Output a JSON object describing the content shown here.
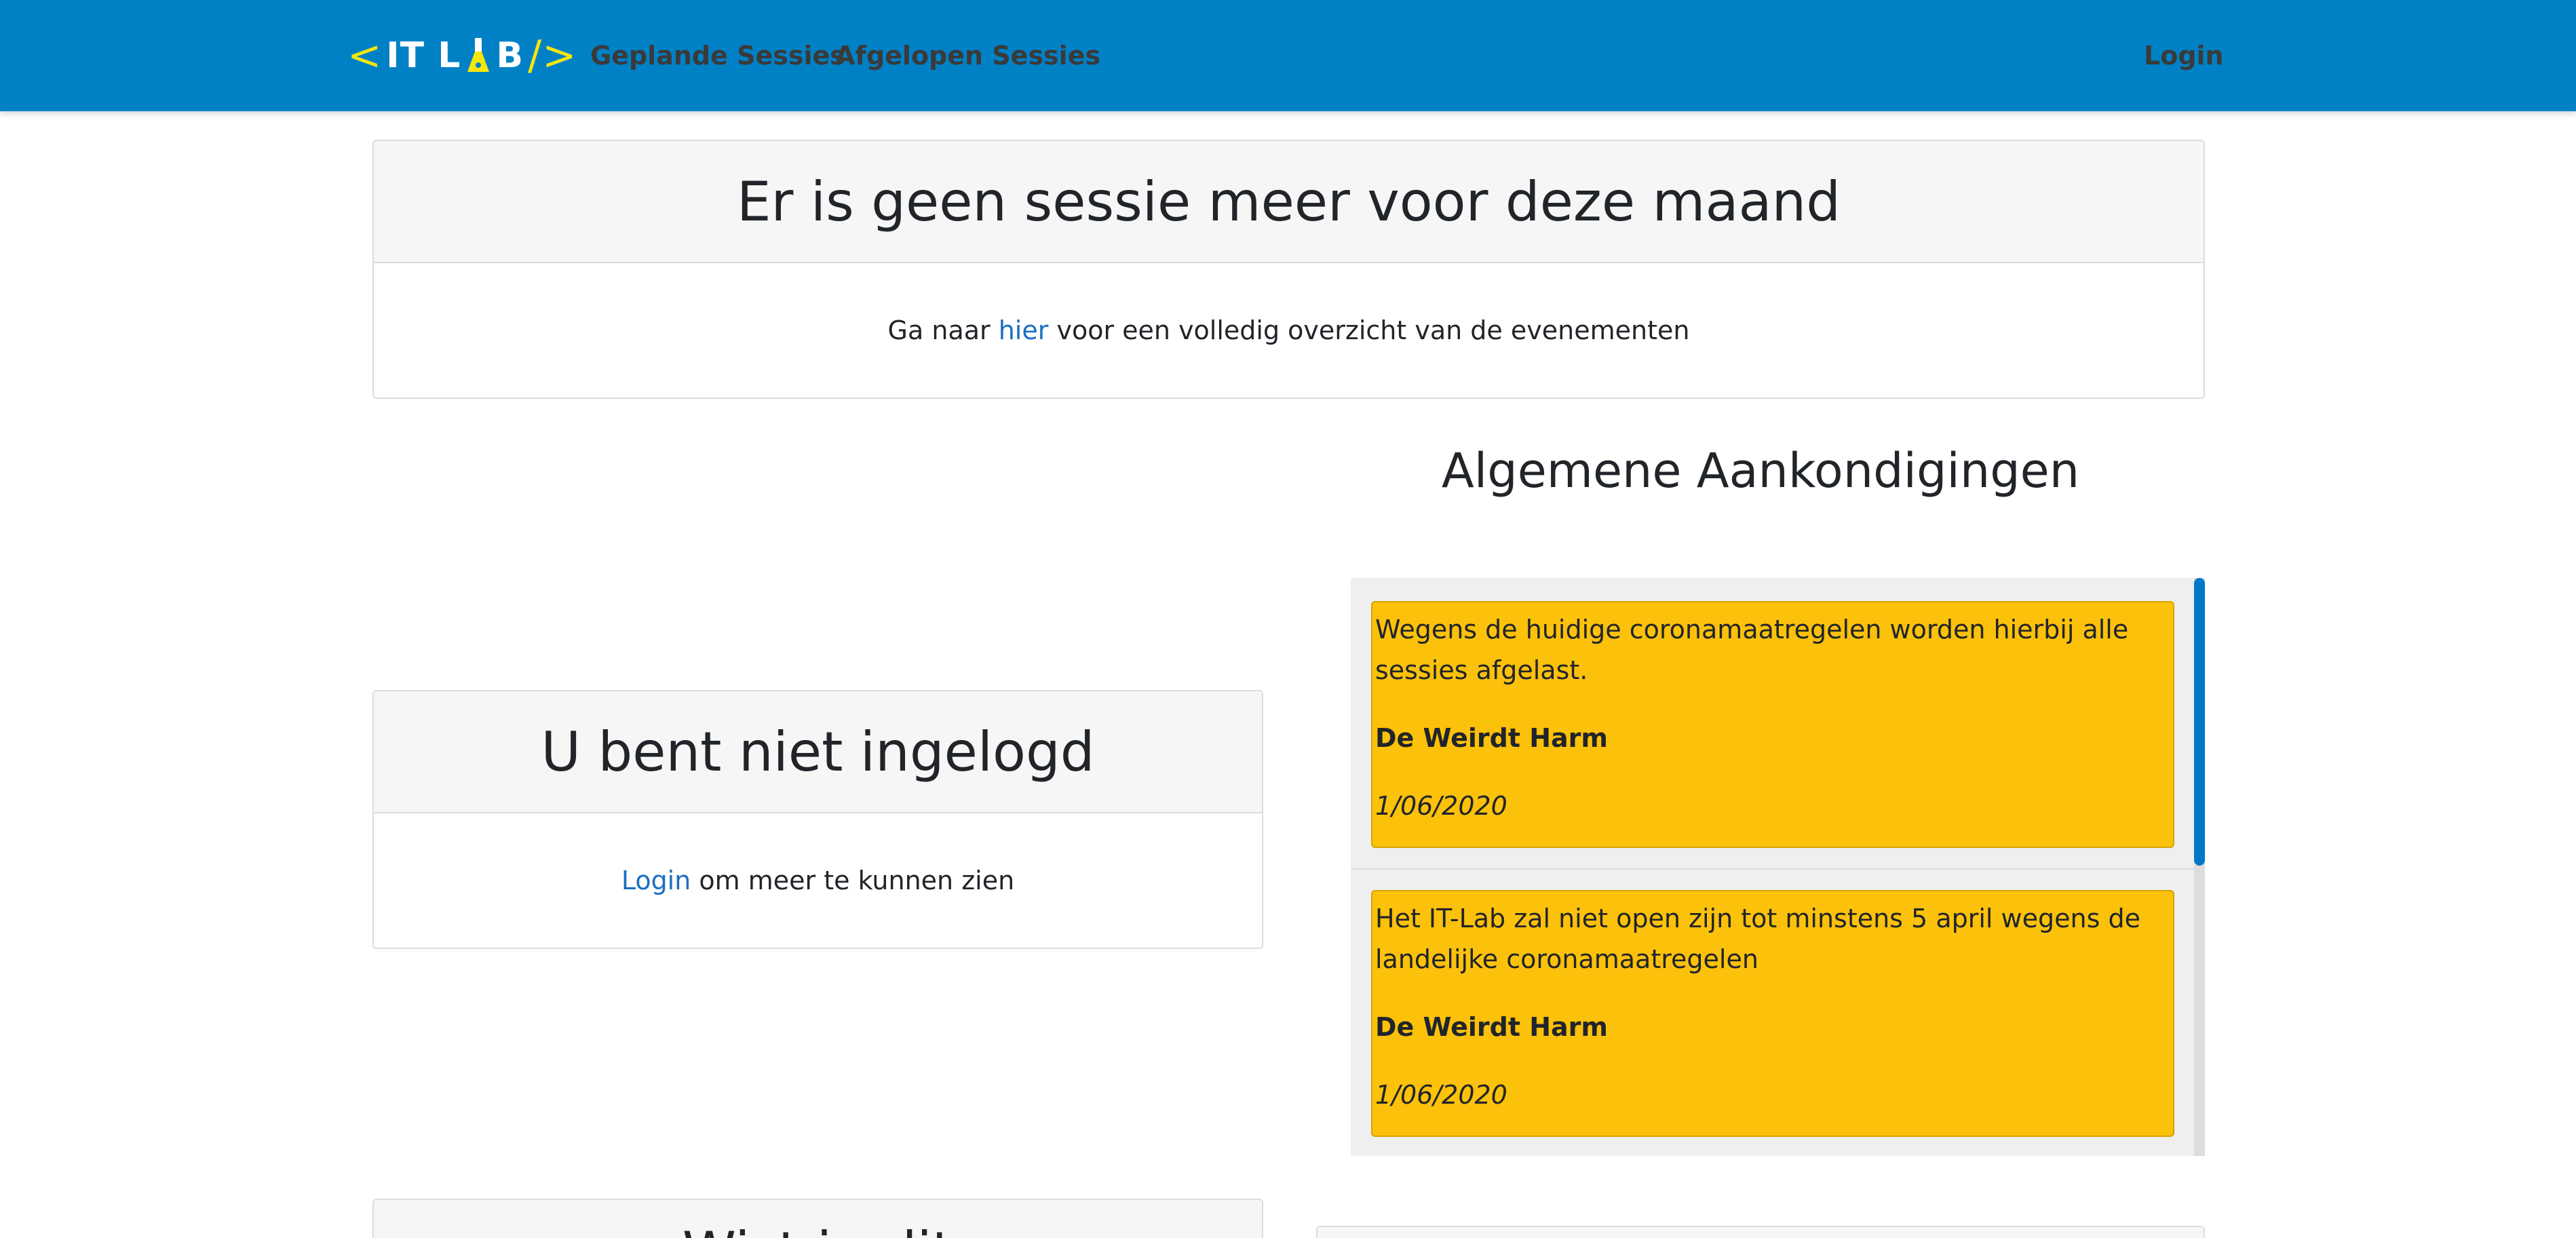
{
  "nav": {
    "logo_left": "<",
    "logo_text_a": "IT L",
    "logo_text_b": "B",
    "logo_right": "/>",
    "geplande": "Geplande Sessies",
    "afgelopen": "Afgelopen Sessies",
    "login": "Login"
  },
  "no_session": {
    "title": "Er is geen sessie meer voor deze maand",
    "body_before": "Ga naar ",
    "link": "hier",
    "body_after": " voor een volledig overzicht van de evenementen"
  },
  "login_card": {
    "title": "U bent niet ingelogd",
    "link": "Login",
    "body_after": " om meer te kunnen zien"
  },
  "announcements": {
    "title": "Algemene Aankondigingen",
    "items": [
      {
        "text": "Wegens de huidige coronamaatregelen worden hierbij alle sessies afgelast.",
        "author": "De Weirdt Harm",
        "date": "1/06/2020"
      },
      {
        "text": "Het IT-Lab zal niet open zijn tot minstens 5 april wegens de landelijke coronamaatregelen",
        "author": "De Weirdt Harm",
        "date": "1/06/2020"
      }
    ]
  },
  "bottom_left": {
    "title": "Wist je dit"
  },
  "colors": {
    "navbar": "#0081c6",
    "logo_accent": "#f5e60d",
    "announcement": "#fcc10a",
    "link": "#1a6fc2"
  }
}
